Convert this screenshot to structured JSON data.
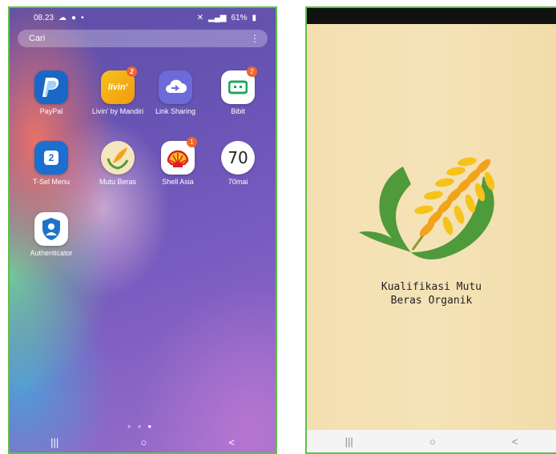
{
  "left_phone": {
    "status": {
      "time": "08.23",
      "battery": "61%"
    },
    "search": {
      "placeholder": "Cari"
    },
    "apps": [
      {
        "label": "PayPal"
      },
      {
        "label": "Livin' by Mandiri",
        "icon_text": "livin'",
        "badge": "2"
      },
      {
        "label": "Link Sharing"
      },
      {
        "label": "Bibit",
        "badge": "2"
      },
      {
        "label": "T-Sel Menu",
        "icon_text": "2"
      },
      {
        "label": "Mutu Beras"
      },
      {
        "label": "Shell Asia",
        "badge": "1"
      },
      {
        "label": "70mai",
        "icon_text": "70"
      },
      {
        "label": "Authenticator"
      }
    ],
    "nav": {
      "recents": "|||",
      "home": "○",
      "back": "<"
    }
  },
  "right_phone": {
    "title_line1": "Kualifikasi Mutu",
    "title_line2": "Beras Organik",
    "nav": {
      "recents": "|||",
      "home": "○",
      "back": "<"
    }
  },
  "colors": {
    "frame_border": "#5fbf4a",
    "splash_bg": "#f4e1b3",
    "logo_green": "#4f9a3a",
    "logo_orange": "#f2a21b"
  }
}
